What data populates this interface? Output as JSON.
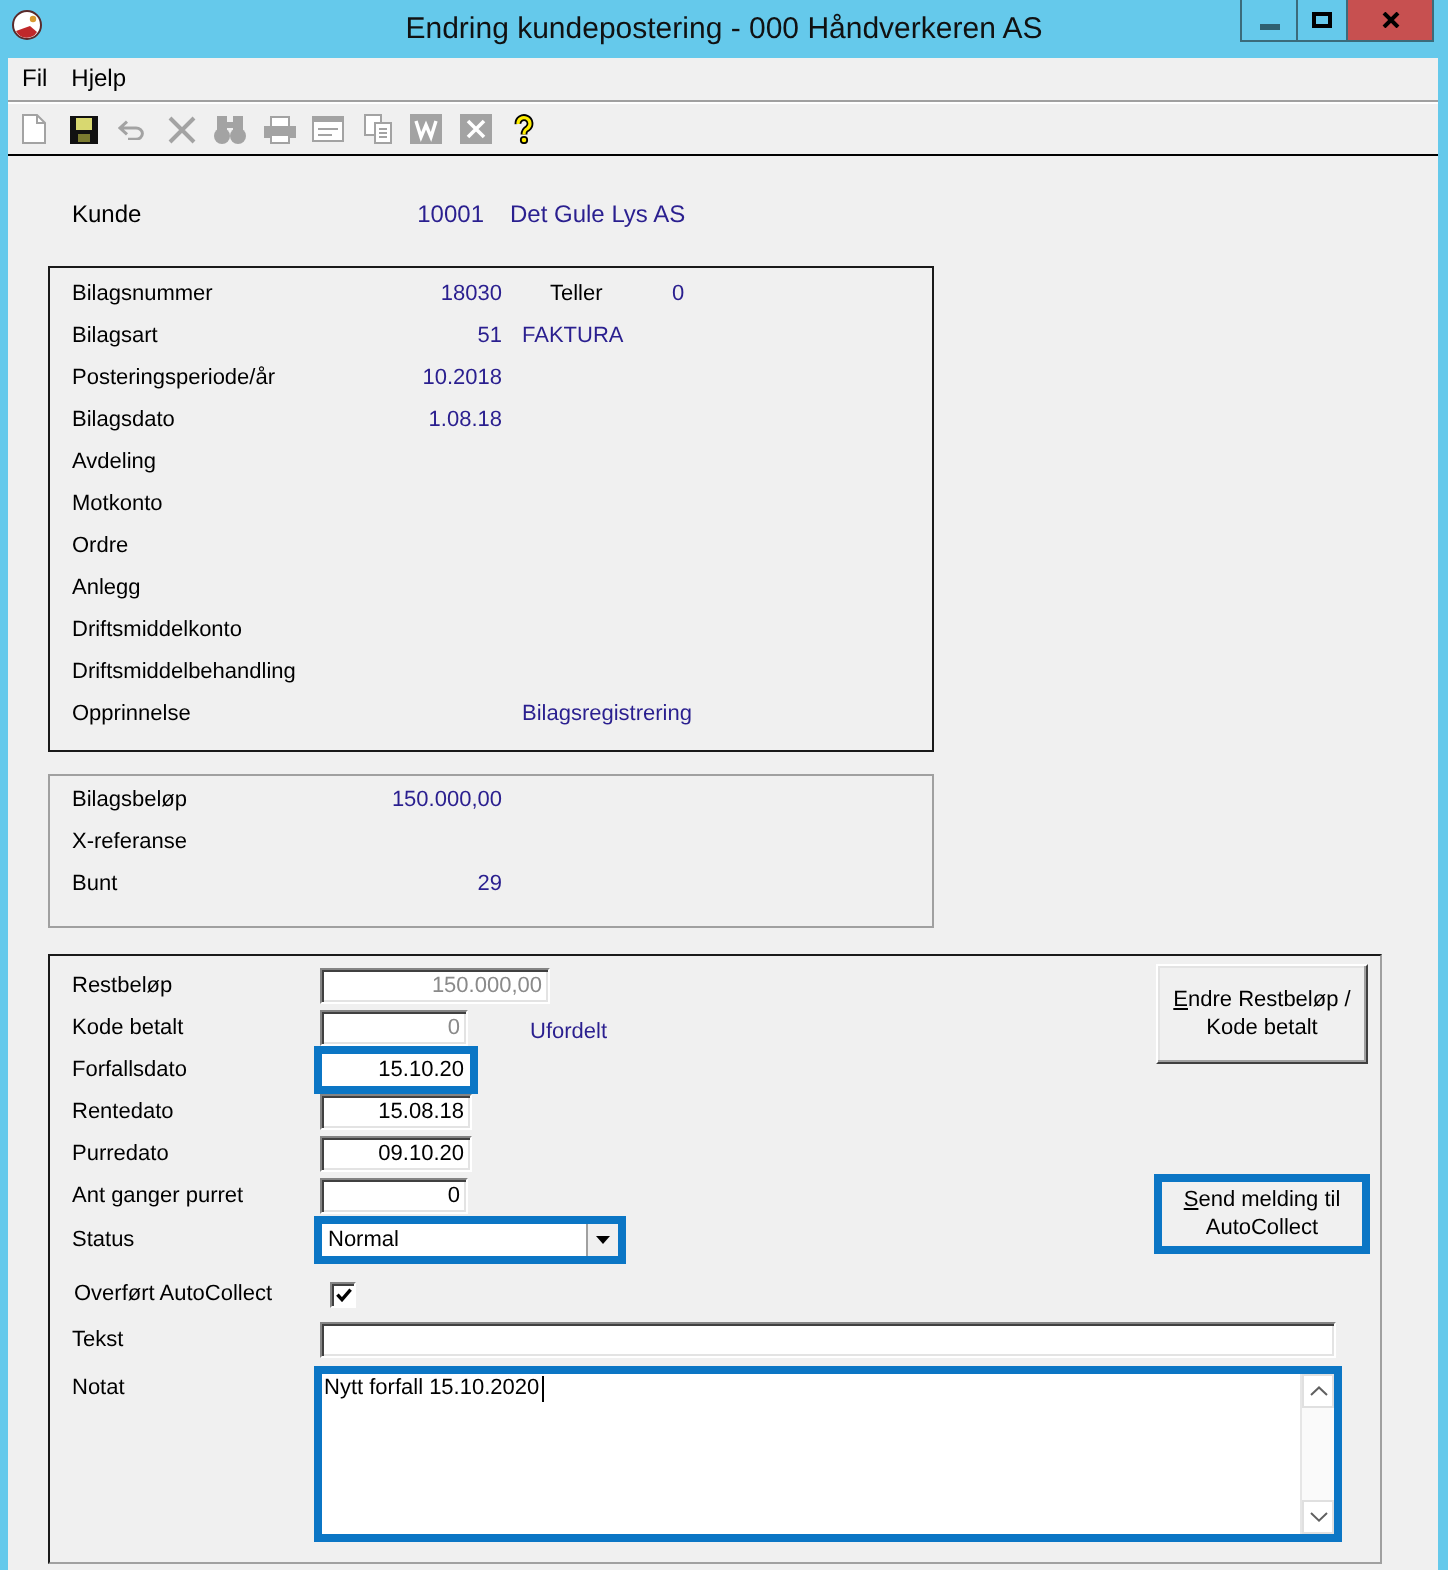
{
  "window": {
    "title": "Endring kundepostering - 000 Håndverkeren AS"
  },
  "menu": [
    "Fil",
    "Hjelp"
  ],
  "toolbar": [
    {
      "kind": "new",
      "disabled": true
    },
    {
      "kind": "save",
      "disabled": false
    },
    {
      "kind": "undo",
      "disabled": true
    },
    {
      "kind": "delete",
      "disabled": true
    },
    {
      "kind": "find",
      "disabled": true
    },
    {
      "kind": "print",
      "disabled": true
    },
    {
      "kind": "form",
      "disabled": true
    },
    {
      "kind": "copy",
      "disabled": true
    },
    {
      "kind": "word",
      "disabled": true
    },
    {
      "kind": "excel",
      "disabled": true
    },
    {
      "kind": "help",
      "disabled": false
    }
  ],
  "customer": {
    "label": "Kunde",
    "number": "10001",
    "name": "Det Gule Lys AS"
  },
  "voucher_panel": {
    "rows": [
      {
        "label": "Bilagsnummer",
        "value": "18030",
        "counter": {
          "label": "Teller",
          "value": "0"
        }
      },
      {
        "label": "Bilagsart",
        "value": "51",
        "note": "FAKTURA"
      },
      {
        "label": "Posteringsperiode/år",
        "value": "10.2018"
      },
      {
        "label": "Bilagsdato",
        "value": "1.08.18"
      },
      {
        "label": "Avdeling"
      },
      {
        "label": "Motkonto"
      },
      {
        "label": "Ordre"
      },
      {
        "label": "Anlegg"
      },
      {
        "label": "Driftsmiddelkonto"
      },
      {
        "label": "Driftsmiddelbehandling"
      },
      {
        "label": "Opprinnelse",
        "note": "Bilagsregistrering"
      }
    ]
  },
  "amount_panel": {
    "rows": [
      {
        "label": "Bilagsbeløp",
        "value": "150.000,00"
      },
      {
        "label": "X-referanse"
      },
      {
        "label": "Bunt",
        "value": "29"
      }
    ]
  },
  "edit_panel": {
    "fields": [
      {
        "label": "Restbeløp",
        "kind": "amount",
        "value": "150.000,00",
        "disabled": true,
        "highlighted": false
      },
      {
        "label": "Kode betalt",
        "kind": "code",
        "value": "0",
        "note": "Ufordelt",
        "disabled": true,
        "highlighted": false
      },
      {
        "label": "Forfallsdato",
        "kind": "date",
        "value": "15.10.20",
        "disabled": false,
        "highlighted": true
      },
      {
        "label": "Rentedato",
        "kind": "date",
        "value": "15.08.18",
        "disabled": false,
        "highlighted": false
      },
      {
        "label": "Purredato",
        "kind": "date",
        "value": "09.10.20",
        "disabled": false,
        "highlighted": false
      },
      {
        "label": "Ant ganger purret",
        "kind": "number",
        "value": "0",
        "disabled": false,
        "highlighted": false
      },
      {
        "label": "Status",
        "kind": "select",
        "value": "Normal",
        "disabled": false,
        "highlighted": true
      }
    ],
    "buttons": [
      {
        "label": "Endre Restbeløp / Kode betalt",
        "underline_first_letter": true,
        "highlighted": false
      },
      {
        "label": "Send melding til AutoCollect",
        "underline_first_letter": true,
        "highlighted": true
      }
    ],
    "lower_fields": [
      {
        "label": "Overført AutoCollect",
        "kind": "checkbox",
        "checked": true
      },
      {
        "label": "Tekst",
        "kind": "text"
      },
      {
        "label": "Notat",
        "kind": "memo",
        "value": "Nytt forfall 15.10.2020",
        "focused": true,
        "highlighted": true
      }
    ]
  }
}
